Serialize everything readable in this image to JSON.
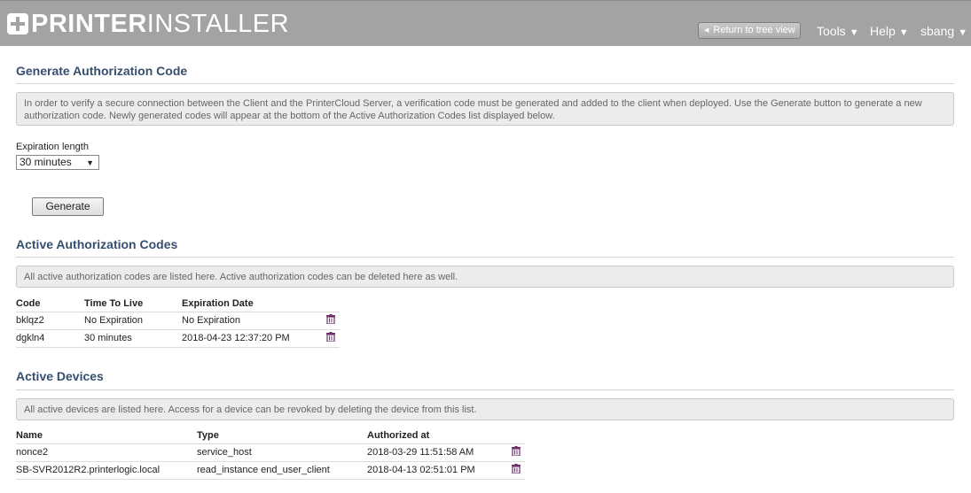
{
  "header": {
    "logo_bold": "PRINTER",
    "logo_light": "INSTALLER",
    "return_label": "Return to tree view",
    "menu_tools": "Tools",
    "menu_help": "Help",
    "menu_user": "sbang",
    "caret": "▼"
  },
  "generate": {
    "title": "Generate Authorization Code",
    "info": "In order to verify a secure connection between the Client and the PrinterCloud Server, a verification code must be generated and added to the client when deployed. Use the Generate button to generate a new authorization code. Newly generated codes will appear at the bottom of the Active Authorization Codes list displayed below.",
    "expiration_label": "Expiration length",
    "expiration_value": "30 minutes",
    "generate_label": "Generate"
  },
  "codes": {
    "title": "Active Authorization Codes",
    "info": "All active authorization codes are listed here. Active authorization codes can be deleted here as well.",
    "columns": [
      "Code",
      "Time To Live",
      "Expiration Date"
    ],
    "rows": [
      [
        "bklqz2",
        "No Expiration",
        "No Expiration"
      ],
      [
        "dgkln4",
        "30 minutes",
        "2018-04-23 12:37:20 PM"
      ]
    ]
  },
  "devices": {
    "title": "Active Devices",
    "info": "All active devices are listed here. Access for a device can be revoked by deleting the device from this list.",
    "columns": [
      "Name",
      "Type",
      "Authorized at"
    ],
    "rows": [
      [
        "nonce2",
        "service_host",
        "2018-03-29 11:51:58 AM"
      ],
      [
        "SB-SVR2012R2.printerlogic.local",
        "read_instance end_user_client",
        "2018-04-13 02:51:01 PM"
      ]
    ]
  },
  "icons": {
    "logo": "plus-cross-icon",
    "return": "caret-left-icon",
    "delete": "trash-icon",
    "dropdown": "chevron-down-icon"
  },
  "colors": {
    "header_bg": "#a3a3a3",
    "section_title": "#354f6e",
    "info_bg": "#ececec",
    "trash": "#6b2f6b"
  }
}
